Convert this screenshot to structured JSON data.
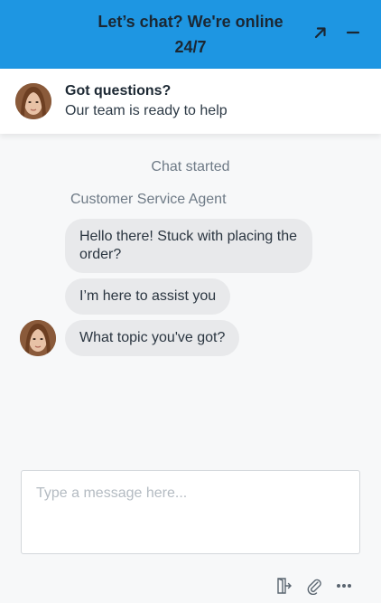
{
  "header": {
    "title": "Let’s chat? We're online 24/7",
    "expand_icon": "arrow-up-right-icon",
    "minimize_icon": "minus-icon",
    "background": "#1e96e2"
  },
  "info": {
    "title": "Got questions?",
    "subtitle": "Our team is ready to help"
  },
  "chat": {
    "system_message": "Chat started",
    "agent_name": "Customer Service Agent",
    "messages": [
      "Hello there! Stuck with placing the order?",
      "I’m here to assist you",
      "What topic you've got?"
    ]
  },
  "composer": {
    "placeholder": "Type a message here..."
  },
  "toolbar": {
    "icons": [
      "exit-chat-icon",
      "paperclip-icon",
      "more-options-icon"
    ]
  }
}
